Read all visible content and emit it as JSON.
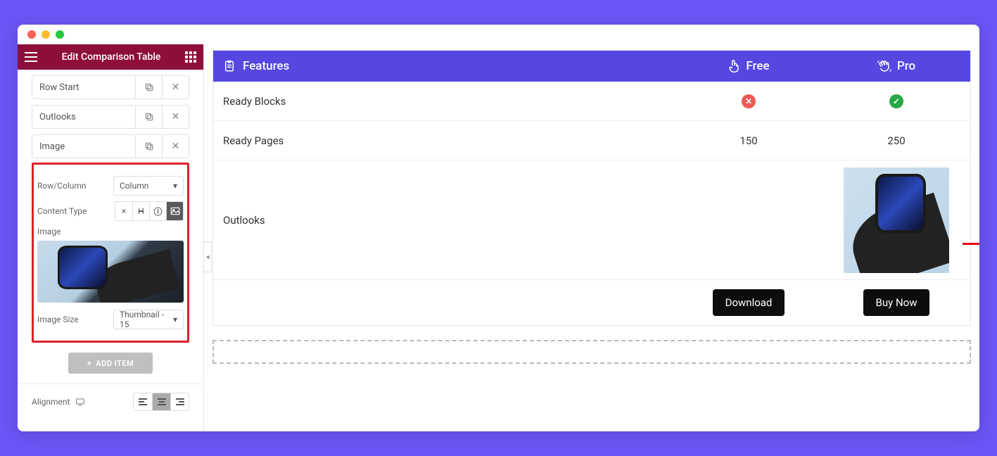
{
  "sidebar": {
    "title": "Edit Comparison Table",
    "items": [
      {
        "label": "Row Start"
      },
      {
        "label": "Outlooks"
      },
      {
        "label": "Image"
      }
    ],
    "row_column_label": "Row/Column",
    "row_column_value": "Column",
    "content_type_label": "Content Type",
    "image_label": "Image",
    "image_size_label": "Image Size",
    "image_size_value": "Thumbnail - 15",
    "add_item_label": "ADD ITEM",
    "alignment_label": "Alignment"
  },
  "table": {
    "header_feature": "Features",
    "header_free": "Free",
    "header_pro": "Pro",
    "rows": [
      {
        "feature": "Ready Blocks",
        "free_status": "no",
        "pro_status": "ok"
      },
      {
        "feature": "Ready Pages",
        "free_value": "150",
        "pro_value": "250"
      }
    ],
    "outlooks_label": "Outlooks",
    "download_label": "Download",
    "buy_now_label": "Buy Now"
  }
}
